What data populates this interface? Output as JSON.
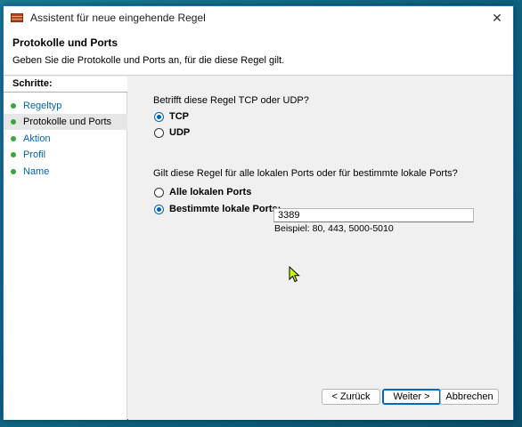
{
  "window": {
    "title": "Assistent für neue eingehende Regel",
    "close_glyph": "✕"
  },
  "header": {
    "title": "Protokolle und Ports",
    "subtitle": "Geben Sie die Protokolle und Ports an, für die diese Regel gilt."
  },
  "sidebar": {
    "heading": "Schritte:",
    "steps": [
      {
        "label": "Regeltyp",
        "active": false
      },
      {
        "label": "Protokolle und Ports",
        "active": true
      },
      {
        "label": "Aktion",
        "active": false
      },
      {
        "label": "Profil",
        "active": false
      },
      {
        "label": "Name",
        "active": false
      }
    ]
  },
  "protocol": {
    "question": "Betrifft diese Regel TCP oder UDP?",
    "options": [
      {
        "label": "TCP",
        "checked": true
      },
      {
        "label": "UDP",
        "checked": false
      }
    ]
  },
  "ports": {
    "question": "Gilt diese Regel für alle lokalen Ports oder für bestimmte lokale Ports?",
    "options": [
      {
        "label": "Alle lokalen Ports",
        "checked": false
      },
      {
        "label": "Bestimmte lokale Ports:",
        "checked": true
      }
    ],
    "value": "3389",
    "hint": "Beispiel: 80, 443, 5000-5010"
  },
  "buttons": {
    "back": "< Zurück",
    "next": "Weiter >",
    "cancel": "Abbrechen"
  },
  "colors": {
    "accent": "#0063b1",
    "step_dot": "#3aa53a"
  }
}
